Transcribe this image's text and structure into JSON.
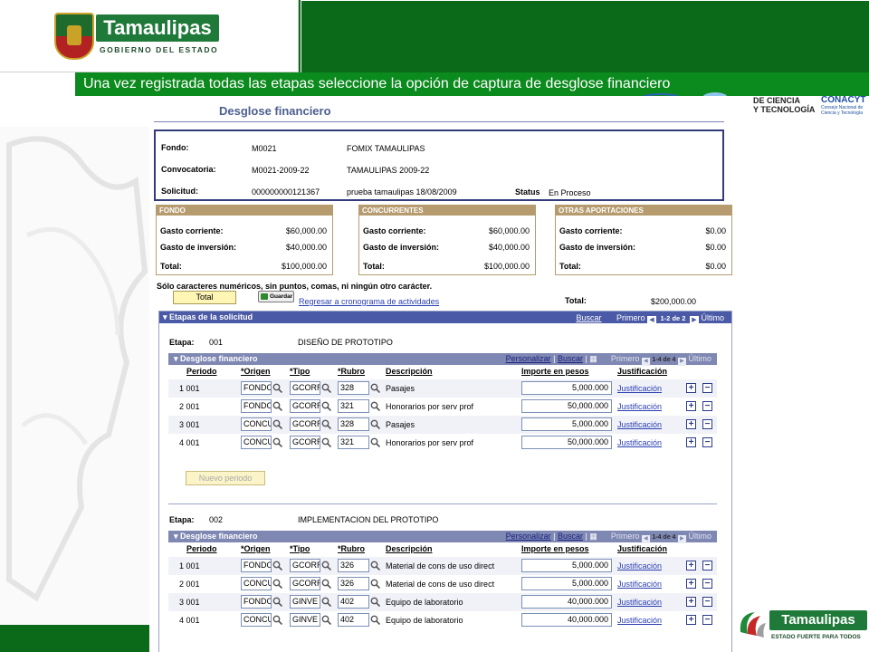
{
  "branding": {
    "top_logo_name": "Tamaulipas",
    "top_logo_subtitle": "GOBIERNO DEL ESTADO",
    "bottom_logo_name": "Tamaulipas",
    "bottom_logo_subtitle": "ESTADO FUERTE PARA TODOS",
    "conacyt_left_line1": "DE CIENCIA",
    "conacyt_left_line2": "Y TECNOLOGÍA",
    "conacyt_name": "CONACYT",
    "conacyt_sub": "Consejo Nacional de Ciencia y Tecnología",
    "colors": {
      "green_dark": "#0b6a1a",
      "green_banner": "#0b8a1d",
      "navy": "#4a5aa6"
    }
  },
  "banner": {
    "text": "Una vez registrada todas las etapas seleccione la opción de captura de desglose financiero"
  },
  "page": {
    "title": "Desglose financiero"
  },
  "info": {
    "fondo_label": "Fondo:",
    "fondo_code": "M0021",
    "fondo_name": "FOMIX TAMAULIPAS",
    "convocatoria_label": "Convocatoria:",
    "convocatoria_code": "M0021-2009-22",
    "convocatoria_name": "TAMAULIPAS 2009-22",
    "solicitud_label": "Solicitud:",
    "solicitud_code": "000000000121367",
    "solicitud_name": "prueba tamaulipas 18/08/2009",
    "status_label": "Status",
    "status_value": "En Proceso"
  },
  "money_boxes": [
    {
      "title": "FONDO",
      "rows": [
        {
          "k": "Gasto corriente:",
          "v": "$60,000.00"
        },
        {
          "k": "Gasto de inversión:",
          "v": "$40,000.00"
        },
        {
          "k": "Total:",
          "v": "$100,000.00"
        }
      ]
    },
    {
      "title": "CONCURRENTES",
      "rows": [
        {
          "k": "Gasto corriente:",
          "v": "$60,000.00"
        },
        {
          "k": "Gasto de inversión:",
          "v": "$40,000.00"
        },
        {
          "k": "Total:",
          "v": "$100,000.00"
        }
      ]
    },
    {
      "title": "OTRAS APORTACIONES",
      "rows": [
        {
          "k": "Gasto corriente:",
          "v": "$0.00"
        },
        {
          "k": "Gasto de inversión:",
          "v": "$0.00"
        },
        {
          "k": "Total:",
          "v": "$0.00"
        }
      ]
    }
  ],
  "toolbar": {
    "note": "Sólo caracteres numéricos, sin puntos, comas, ni ningún otro carácter.",
    "total_button": "Total",
    "guardar_button": "Guardar",
    "regresar_link": "Regresar a cronograma de actividades",
    "total_label": "Total:",
    "total_value": "$200,000.00"
  },
  "etapas": {
    "header": "Etapas de la solicitud",
    "buscar": "Buscar",
    "primero": "Primero",
    "page_count": "1-2 de 2",
    "ultimo": "Último",
    "etapa_label": "Etapa:",
    "grid_title": "Desglose financiero",
    "personalizar": "Personalizar",
    "grid_buscar": "Buscar",
    "grid_primero": "Primero",
    "grid_ultimo": "Último",
    "col_periodo": "Periodo",
    "col_origen": "*Origen",
    "col_tipo": "*Tipo",
    "col_rubro": "*Rubro",
    "col_descripcion": "Descripción",
    "col_importe": "Importe en pesos",
    "col_justificacion": "Justificación",
    "justificacion_link": "Justificación",
    "nuevo_periodo": "Nuevo periodo",
    "stages": [
      {
        "number": "001",
        "name": "DISEÑO DE PROTOTIPO",
        "grid_count": "1-4 de 4",
        "rows": [
          {
            "periodo": "1 001",
            "origen": "FONDO",
            "tipo": "GCORR",
            "rubro": "328",
            "descripcion": "Pasajes",
            "importe": "5,000.000"
          },
          {
            "periodo": "2 001",
            "origen": "FONDO",
            "tipo": "GCORR",
            "rubro": "321",
            "descripcion": "Honorarios por serv prof",
            "importe": "50,000.000"
          },
          {
            "periodo": "3 001",
            "origen": "CONCU",
            "tipo": "GCORR",
            "rubro": "328",
            "descripcion": "Pasajes",
            "importe": "5,000.000"
          },
          {
            "periodo": "4 001",
            "origen": "CONCU",
            "tipo": "GCORR",
            "rubro": "321",
            "descripcion": "Honorarios por serv prof",
            "importe": "50,000.000"
          }
        ]
      },
      {
        "number": "002",
        "name": "IMPLEMENTACION DEL PROTOTIPO",
        "grid_count": "1-4 de 4",
        "rows": [
          {
            "periodo": "1 001",
            "origen": "FONDO",
            "tipo": "GCORR",
            "rubro": "326",
            "descripcion": "Material de cons de uso direct",
            "importe": "5,000.000"
          },
          {
            "periodo": "2 001",
            "origen": "CONCU",
            "tipo": "GCORR",
            "rubro": "326",
            "descripcion": "Material de cons de uso direct",
            "importe": "5,000.000"
          },
          {
            "periodo": "3 001",
            "origen": "FONDO",
            "tipo": "GINVE",
            "rubro": "402",
            "descripcion": "Equipo de laboratorio",
            "importe": "40,000.000"
          },
          {
            "periodo": "4 001",
            "origen": "CONCU",
            "tipo": "GINVE",
            "rubro": "402",
            "descripcion": "Equipo de laboratorio",
            "importe": "40,000.000"
          }
        ]
      }
    ]
  }
}
